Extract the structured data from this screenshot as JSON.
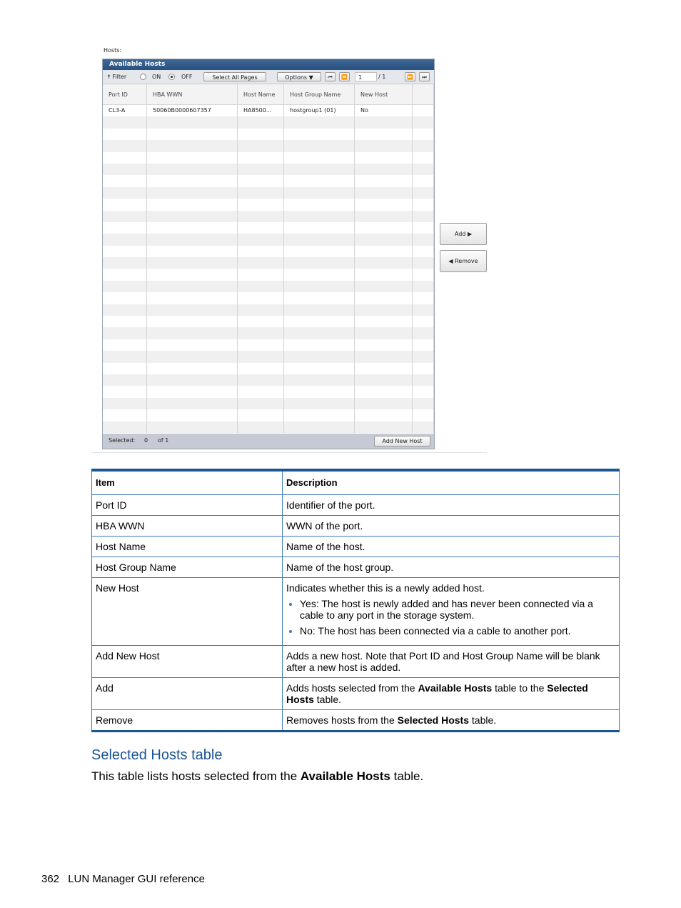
{
  "screenshot": {
    "hosts_label": "Hosts:",
    "panel_title": "Available Hosts",
    "toolbar": {
      "filter_label": "Filter",
      "on_label": "ON",
      "off_label": "OFF",
      "filter_state": "OFF",
      "select_all_label": "Select All Pages",
      "options_label": "Options",
      "page_current": "1",
      "page_total": "/ 1"
    },
    "columns": [
      "Port ID",
      "HBA WWN",
      "Host Name",
      "Host Group Name",
      "New Host"
    ],
    "rows": [
      [
        "CL3-A",
        "50060B0000607357",
        "HA8500...",
        "hostgroup1 (01)",
        "No"
      ]
    ],
    "footer": {
      "selected_label": "Selected:",
      "selected_count": "0",
      "of_label": "of 1",
      "add_new_host_label": "Add New Host"
    },
    "add_label": "Add",
    "remove_label": "Remove"
  },
  "doc_table": {
    "headers": [
      "Item",
      "Description"
    ],
    "rows": [
      {
        "item": "Port ID",
        "desc": "Identifier of the port."
      },
      {
        "item": "HBA WWN",
        "desc": "WWN of the port."
      },
      {
        "item": "Host Name",
        "desc": "Name of the host."
      },
      {
        "item": "Host Group Name",
        "desc": "Name of the host group."
      },
      {
        "item": "New Host",
        "desc": "Indicates whether this is a newly added host.",
        "bullets": [
          "Yes: The host is newly added and has never been connected via a cable to any port in the storage system.",
          "No: The host has been connected via a cable to another port."
        ]
      },
      {
        "item": "Add New Host",
        "desc": "Adds a new host. Note that Port ID and Host Group Name will be blank after a new host is added."
      },
      {
        "item": "Add",
        "desc_parts": [
          "Adds hosts selected from the ",
          "Available Hosts",
          " table to the ",
          "Selected Hosts",
          " table."
        ]
      },
      {
        "item": "Remove",
        "desc_parts": [
          "Removes hosts from the ",
          "Selected Hosts",
          " table."
        ]
      }
    ]
  },
  "section": {
    "title": "Selected Hosts table",
    "text_parts": [
      "This table lists hosts selected from the ",
      "Available Hosts",
      " table."
    ]
  },
  "page_footer": {
    "page_number": "362",
    "title": "LUN Manager GUI reference"
  },
  "colors": {
    "accent": "#1a5494",
    "panel_title_bg": "#2f5986"
  }
}
